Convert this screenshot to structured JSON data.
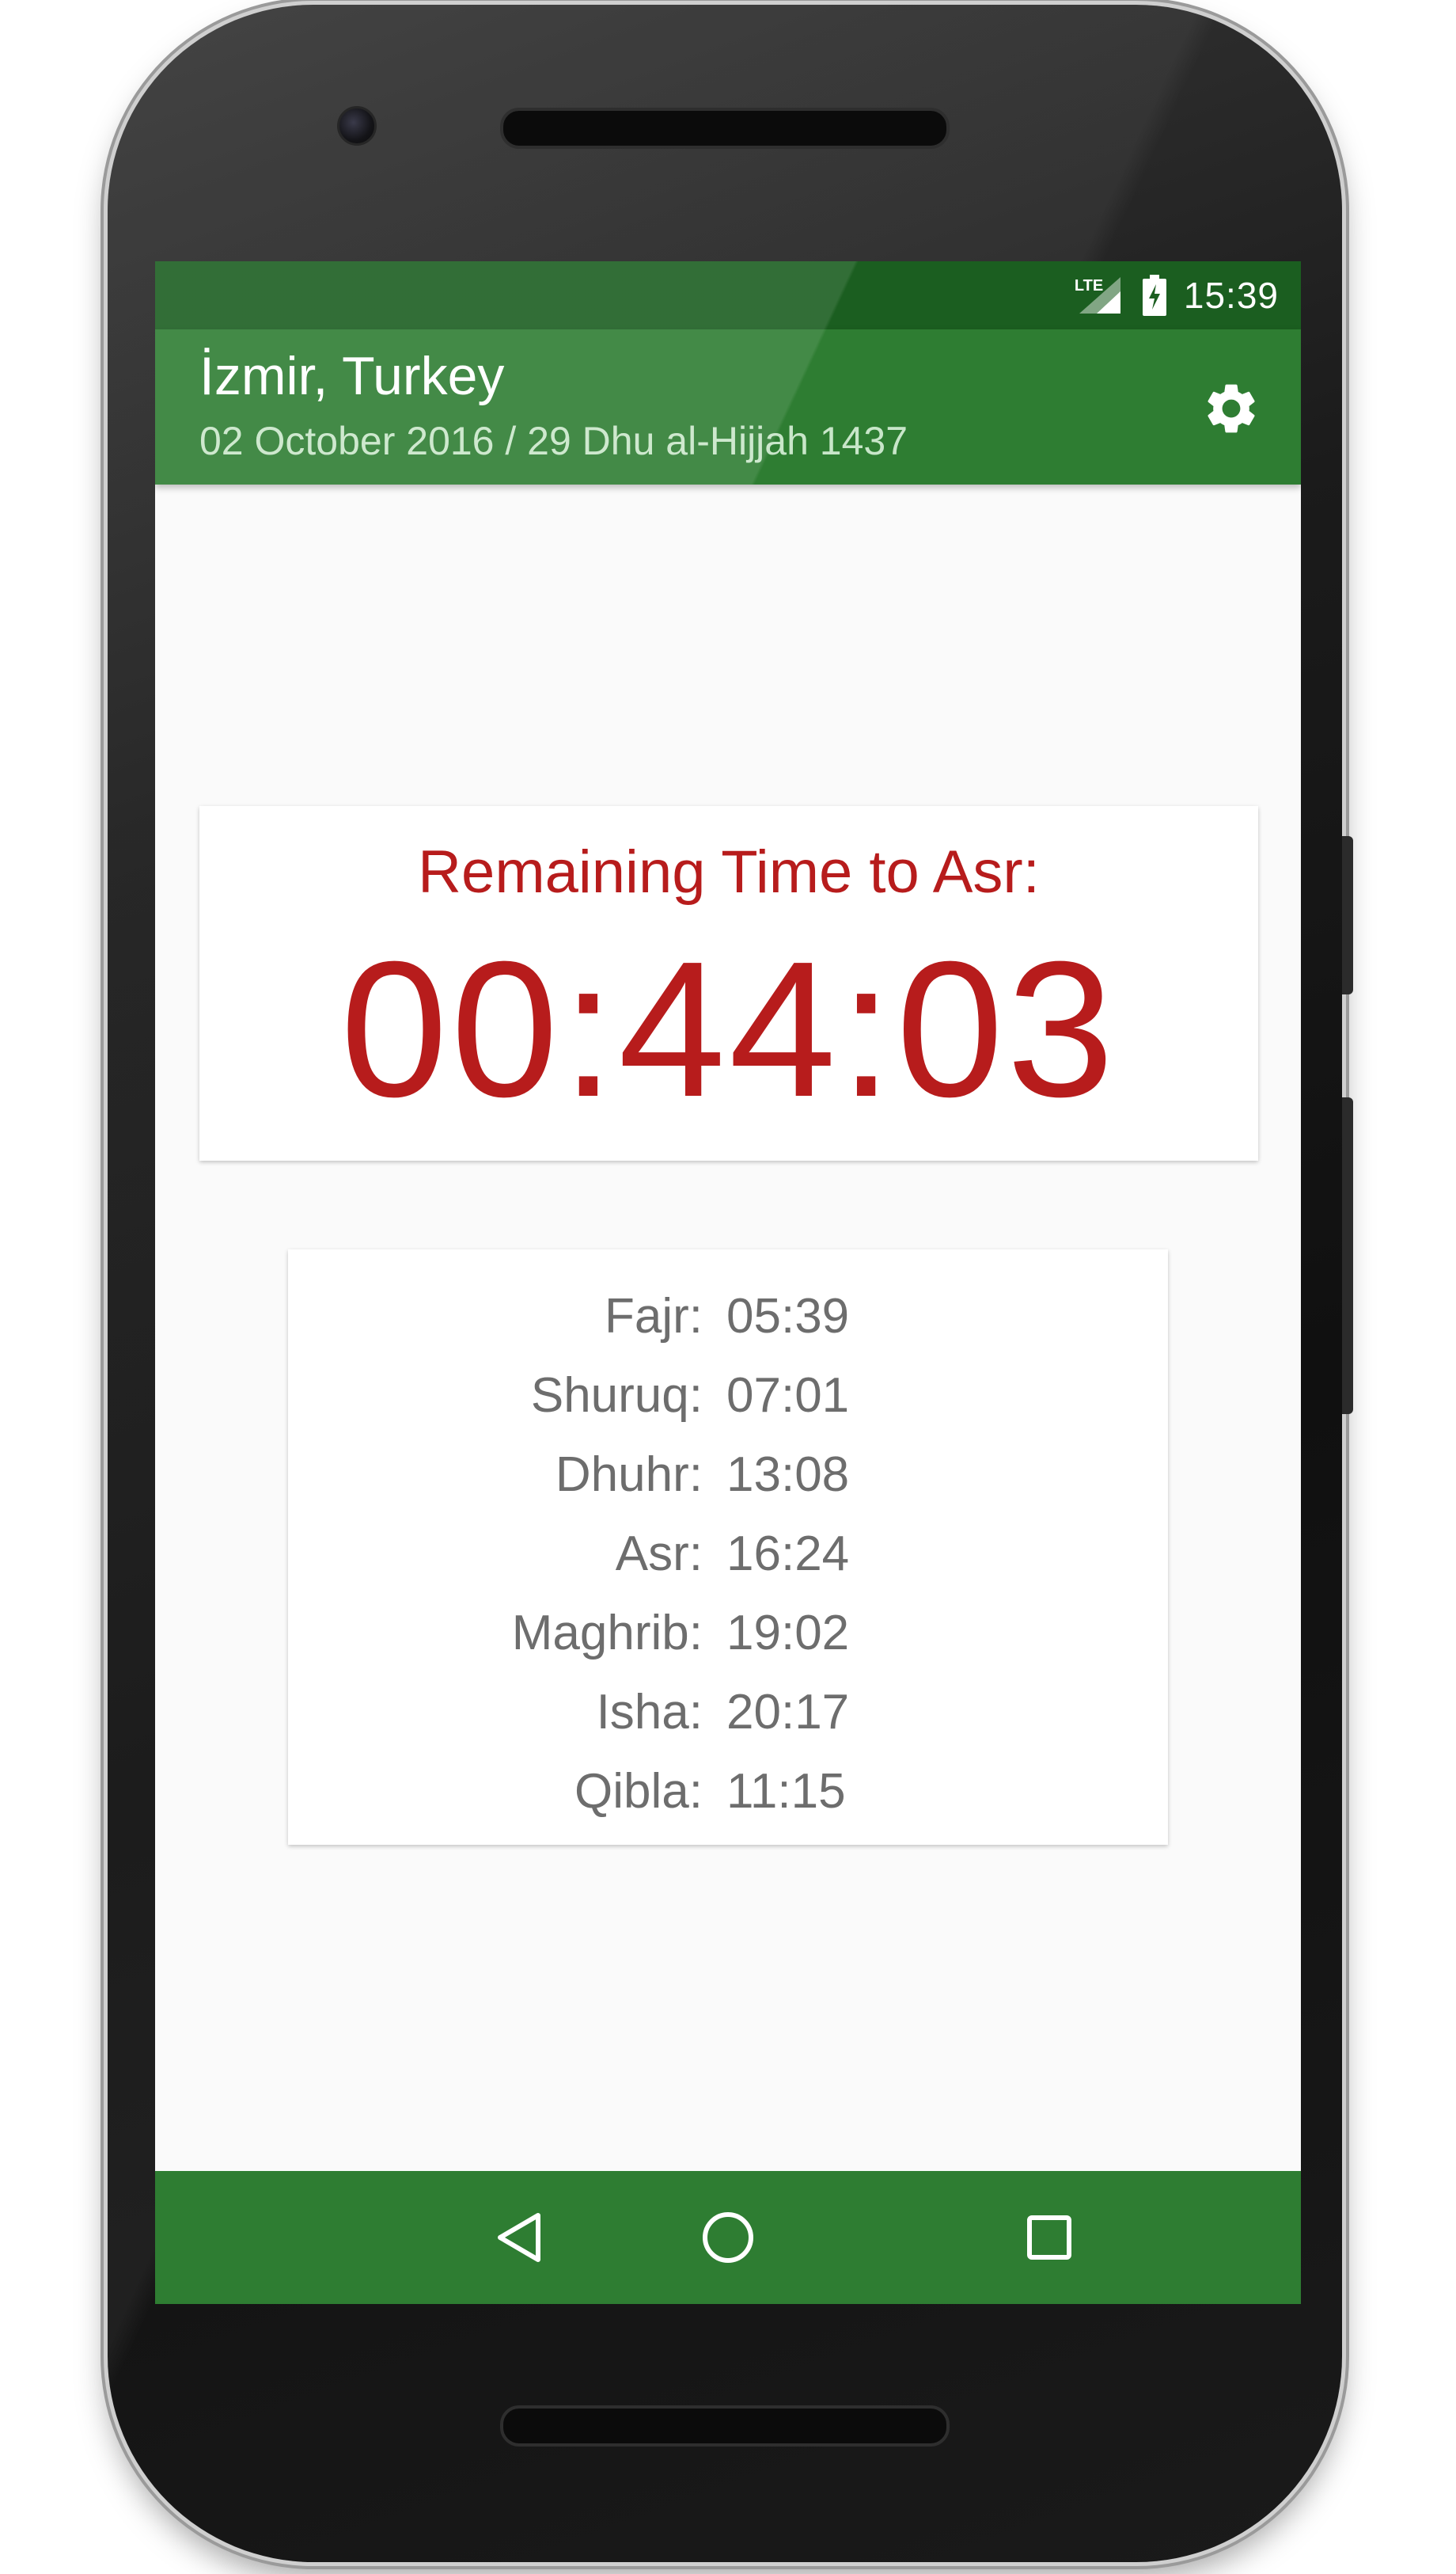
{
  "status_bar": {
    "network_label": "LTE",
    "clock": "15:39"
  },
  "app_bar": {
    "title": "İzmir, Turkey",
    "subtitle": "02 October 2016 / 29 Dhu al-Hijjah 1437",
    "settings_icon": "gear-icon"
  },
  "countdown": {
    "label": "Remaining Time to Asr:",
    "value": "00:44:03",
    "color": "#b71c1c"
  },
  "prayer_times": [
    {
      "name": "Fajr:",
      "time": "05:39"
    },
    {
      "name": "Shuruq:",
      "time": "07:01"
    },
    {
      "name": "Dhuhr:",
      "time": "13:08"
    },
    {
      "name": "Asr:",
      "time": "16:24"
    },
    {
      "name": "Maghrib:",
      "time": "19:02"
    },
    {
      "name": "Isha:",
      "time": "20:17"
    },
    {
      "name": "Qibla:",
      "time": "11:15"
    }
  ],
  "nav_bar": {
    "back_icon": "back-triangle-icon",
    "home_icon": "home-circle-icon",
    "recents_icon": "recents-square-icon"
  },
  "theme": {
    "primary": "#2e7d32",
    "primary_dark": "#1b5e20",
    "accent_text": "#b71c1c"
  }
}
